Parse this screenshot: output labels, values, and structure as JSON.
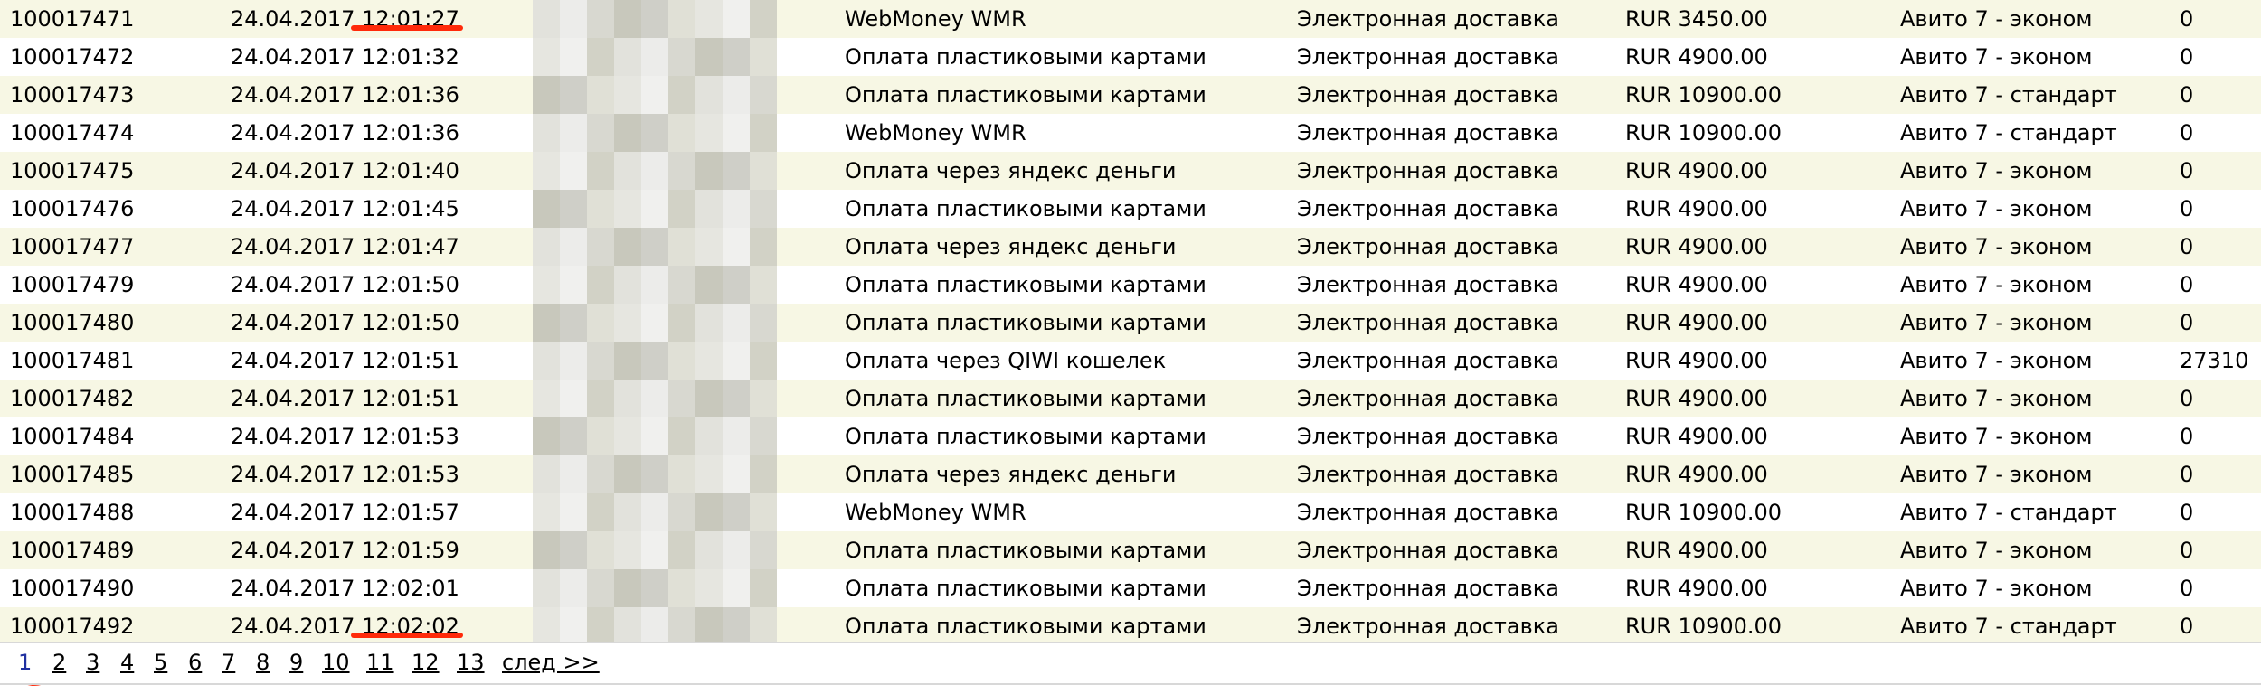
{
  "rows": [
    {
      "id": "100017471",
      "date": "24.04.2017 12:01:27",
      "payment": "WebMoney WMR",
      "delivery": "Электронная доставка",
      "sum": "RUR 3450.00",
      "tariff": "Авито 7 - эконом",
      "extra": "0"
    },
    {
      "id": "100017472",
      "date": "24.04.2017 12:01:32",
      "payment": "Оплата пластиковыми картами",
      "delivery": "Электронная доставка",
      "sum": "RUR 4900.00",
      "tariff": "Авито 7 - эконом",
      "extra": "0"
    },
    {
      "id": "100017473",
      "date": "24.04.2017 12:01:36",
      "payment": "Оплата пластиковыми картами",
      "delivery": "Электронная доставка",
      "sum": "RUR 10900.00",
      "tariff": "Авито 7 - стандарт",
      "extra": "0"
    },
    {
      "id": "100017474",
      "date": "24.04.2017 12:01:36",
      "payment": "WebMoney WMR",
      "delivery": "Электронная доставка",
      "sum": "RUR 10900.00",
      "tariff": "Авито 7 - стандарт",
      "extra": "0"
    },
    {
      "id": "100017475",
      "date": "24.04.2017 12:01:40",
      "payment": "Оплата через яндекс деньги",
      "delivery": "Электронная доставка",
      "sum": "RUR 4900.00",
      "tariff": "Авито 7 - эконом",
      "extra": "0"
    },
    {
      "id": "100017476",
      "date": "24.04.2017 12:01:45",
      "payment": "Оплата пластиковыми картами",
      "delivery": "Электронная доставка",
      "sum": "RUR 4900.00",
      "tariff": "Авито 7 - эконом",
      "extra": "0"
    },
    {
      "id": "100017477",
      "date": "24.04.2017 12:01:47",
      "payment": "Оплата через яндекс деньги",
      "delivery": "Электронная доставка",
      "sum": "RUR 4900.00",
      "tariff": "Авито 7 - эконом",
      "extra": "0"
    },
    {
      "id": "100017479",
      "date": "24.04.2017 12:01:50",
      "payment": "Оплата пластиковыми картами",
      "delivery": "Электронная доставка",
      "sum": "RUR 4900.00",
      "tariff": "Авито 7 - эконом",
      "extra": "0"
    },
    {
      "id": "100017480",
      "date": "24.04.2017 12:01:50",
      "payment": "Оплата пластиковыми картами",
      "delivery": "Электронная доставка",
      "sum": "RUR 4900.00",
      "tariff": "Авито 7 - эконом",
      "extra": "0"
    },
    {
      "id": "100017481",
      "date": "24.04.2017 12:01:51",
      "payment": "Оплата через QIWI кошелек",
      "delivery": "Электронная доставка",
      "sum": "RUR 4900.00",
      "tariff": "Авито 7 - эконом",
      "extra": "27310"
    },
    {
      "id": "100017482",
      "date": "24.04.2017 12:01:51",
      "payment": "Оплата пластиковыми картами",
      "delivery": "Электронная доставка",
      "sum": "RUR 4900.00",
      "tariff": "Авито 7 - эконом",
      "extra": "0"
    },
    {
      "id": "100017484",
      "date": "24.04.2017 12:01:53",
      "payment": "Оплата пластиковыми картами",
      "delivery": "Электронная доставка",
      "sum": "RUR 4900.00",
      "tariff": "Авито 7 - эконом",
      "extra": "0"
    },
    {
      "id": "100017485",
      "date": "24.04.2017 12:01:53",
      "payment": "Оплата через яндекс деньги",
      "delivery": "Электронная доставка",
      "sum": "RUR 4900.00",
      "tariff": "Авито 7 - эконом",
      "extra": "0"
    },
    {
      "id": "100017488",
      "date": "24.04.2017 12:01:57",
      "payment": "WebMoney WMR",
      "delivery": "Электронная доставка",
      "sum": "RUR 10900.00",
      "tariff": "Авито 7 - стандарт",
      "extra": "0"
    },
    {
      "id": "100017489",
      "date": "24.04.2017 12:01:59",
      "payment": "Оплата пластиковыми картами",
      "delivery": "Электронная доставка",
      "sum": "RUR 4900.00",
      "tariff": "Авито 7 - эконом",
      "extra": "0"
    },
    {
      "id": "100017490",
      "date": "24.04.2017 12:02:01",
      "payment": "Оплата пластиковыми картами",
      "delivery": "Электронная доставка",
      "sum": "RUR 4900.00",
      "tariff": "Авито 7 - эконом",
      "extra": "0"
    },
    {
      "id": "100017492",
      "date": "24.04.2017 12:02:02",
      "payment": "Оплата пластиковыми картами",
      "delivery": "Электронная доставка",
      "sum": "RUR 10900.00",
      "tariff": "Авито 7 - стандарт",
      "extra": "0"
    }
  ],
  "pagination": {
    "pages": [
      "1",
      "2",
      "3",
      "4",
      "5",
      "6",
      "7",
      "8",
      "9",
      "10",
      "11",
      "12",
      "13"
    ],
    "current": "1",
    "next_label": "след >>"
  },
  "colors": {
    "row_stripe": "#f7f7e4",
    "annotation_red": "#ff2a0a",
    "current_page": "#2030a0"
  }
}
